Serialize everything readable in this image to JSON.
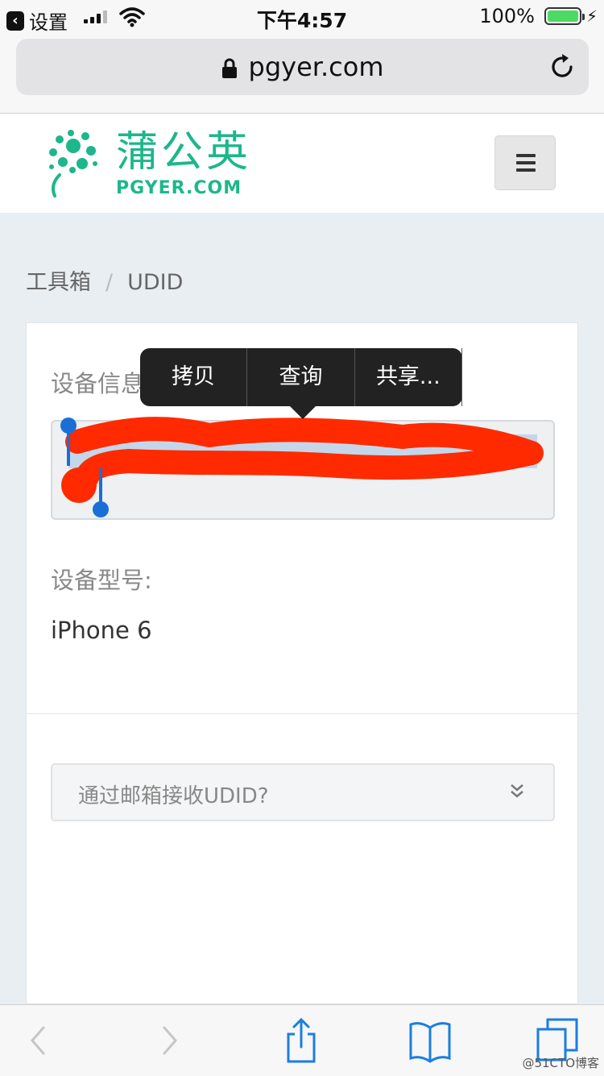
{
  "status_bar": {
    "back_label": "设置",
    "time": "下午4:57",
    "battery": "100%"
  },
  "browser": {
    "url": "pgyer.com"
  },
  "site": {
    "logo_cn": "蒲公英",
    "logo_en": "PGYER.COM",
    "brand_color": "#1cb78b"
  },
  "breadcrumb": {
    "root": "工具箱",
    "separator": "/",
    "current": "UDID"
  },
  "device": {
    "info_label": "设备信息",
    "udid_value": "",
    "model_label": "设备型号:",
    "model_value": "iPhone 6"
  },
  "context_menu": {
    "items": [
      "拷贝",
      "查询",
      "共享..."
    ]
  },
  "email": {
    "label": "通过邮箱接收UDID?"
  },
  "watermark": "@51CTO博客",
  "icons": {
    "back": "back-arrow-icon",
    "lock": "lock-icon",
    "reload": "reload-icon",
    "menu": "hamburger-icon",
    "share": "share-icon",
    "bookmarks": "bookmarks-icon",
    "tabs": "tabs-icon"
  }
}
